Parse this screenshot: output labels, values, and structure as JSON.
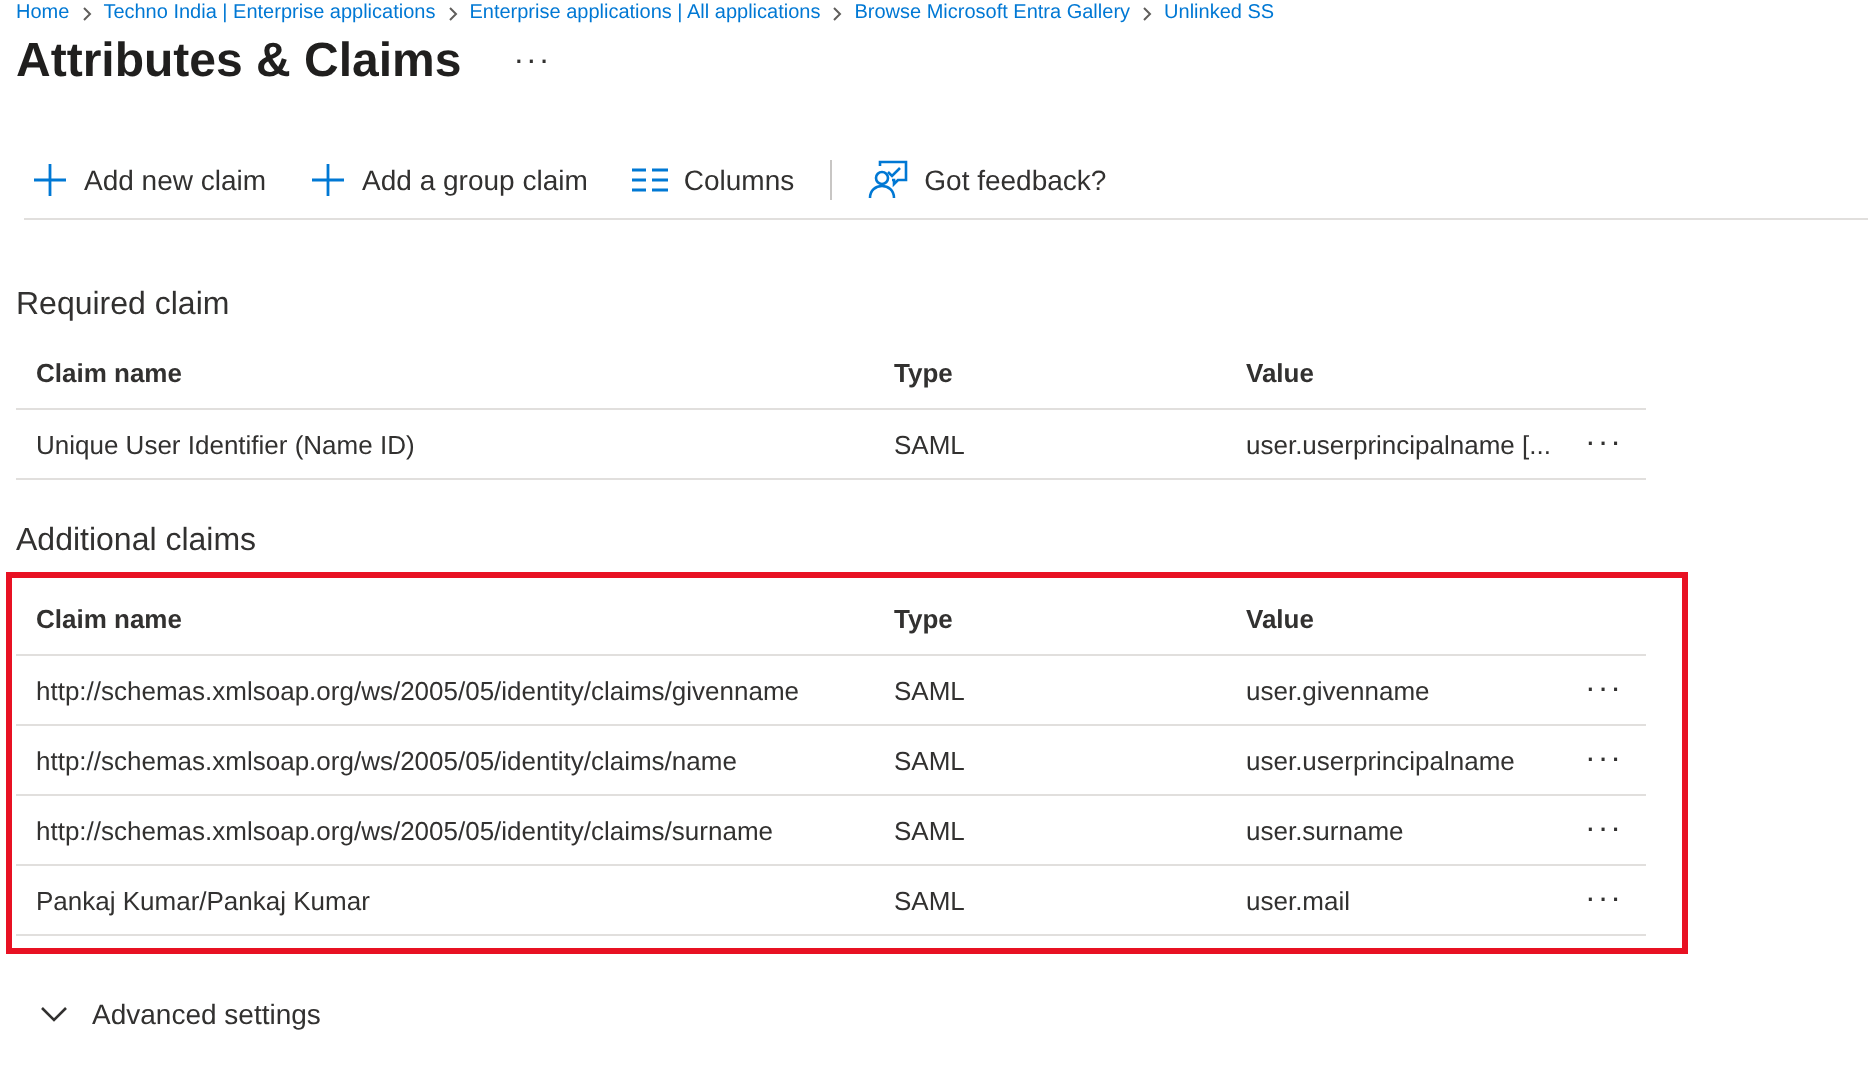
{
  "breadcrumb": [
    "Home",
    "Techno India | Enterprise applications",
    "Enterprise applications | All applications",
    "Browse Microsoft Entra Gallery",
    "Unlinked SS"
  ],
  "title": "Attributes & Claims",
  "more": "···",
  "toolbar": [
    {
      "kind": "plus",
      "label": "Add new claim"
    },
    {
      "kind": "plus",
      "label": "Add a group claim"
    },
    {
      "kind": "columns",
      "label": "Columns"
    },
    {
      "kind": "feedback",
      "label": "Got feedback?"
    }
  ],
  "sections": [
    {
      "title": "Required claim",
      "highlighted": false,
      "columns": [
        "Claim name",
        "Type",
        "Value"
      ],
      "rows": [
        [
          "Unique User Identifier (Name ID)",
          "SAML",
          "user.userprincipalname [..."
        ]
      ]
    },
    {
      "title": "Additional claims",
      "highlighted": true,
      "columns": [
        "Claim name",
        "Type",
        "Value"
      ],
      "rows": [
        [
          "http://schemas.xmlsoap.org/ws/2005/05/identity/claims/givenname",
          "SAML",
          "user.givenname"
        ],
        [
          "http://schemas.xmlsoap.org/ws/2005/05/identity/claims/name",
          "SAML",
          "user.userprincipalname"
        ],
        [
          "http://schemas.xmlsoap.org/ws/2005/05/identity/claims/surname",
          "SAML",
          "user.surname"
        ],
        [
          "Pankaj Kumar/Pankaj Kumar",
          "SAML",
          "user.mail"
        ]
      ]
    }
  ],
  "advanced": {
    "label": "Advanced settings",
    "expanded": false
  }
}
